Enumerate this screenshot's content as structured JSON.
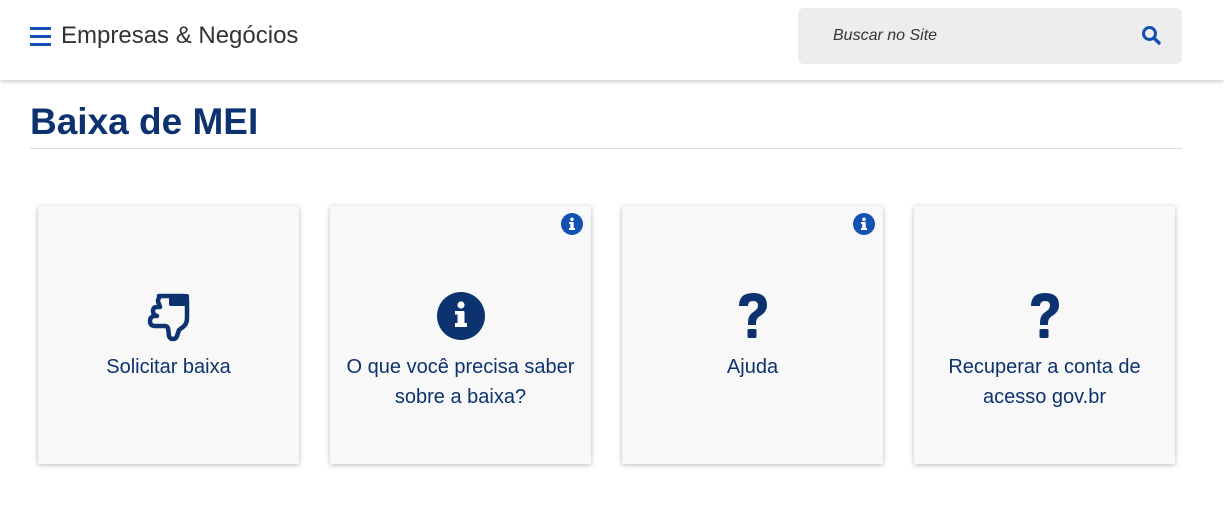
{
  "header": {
    "site_title": "Empresas & Negócios",
    "search": {
      "placeholder": "Buscar no Site"
    },
    "icons": {
      "menu": "hamburger-menu-icon",
      "search": "search-icon"
    }
  },
  "page": {
    "title": "Baixa de MEI"
  },
  "cards": [
    {
      "label": "Solicitar baixa",
      "icon": "pointing-hand-icon",
      "has_info": false
    },
    {
      "label": "O que você precisa saber sobre a baixa?",
      "icon": "info-circle-icon",
      "has_info": true
    },
    {
      "label": "Ajuda",
      "icon": "question-mark-icon",
      "has_info": true
    },
    {
      "label": "Recuperar a conta de acesso gov.br",
      "icon": "question-mark-icon",
      "has_info": false
    }
  ],
  "colors": {
    "primary_blue": "#1351b4",
    "dark_blue": "#0c326f",
    "card_bg": "#f8f8f8",
    "search_bg": "#ededed"
  }
}
